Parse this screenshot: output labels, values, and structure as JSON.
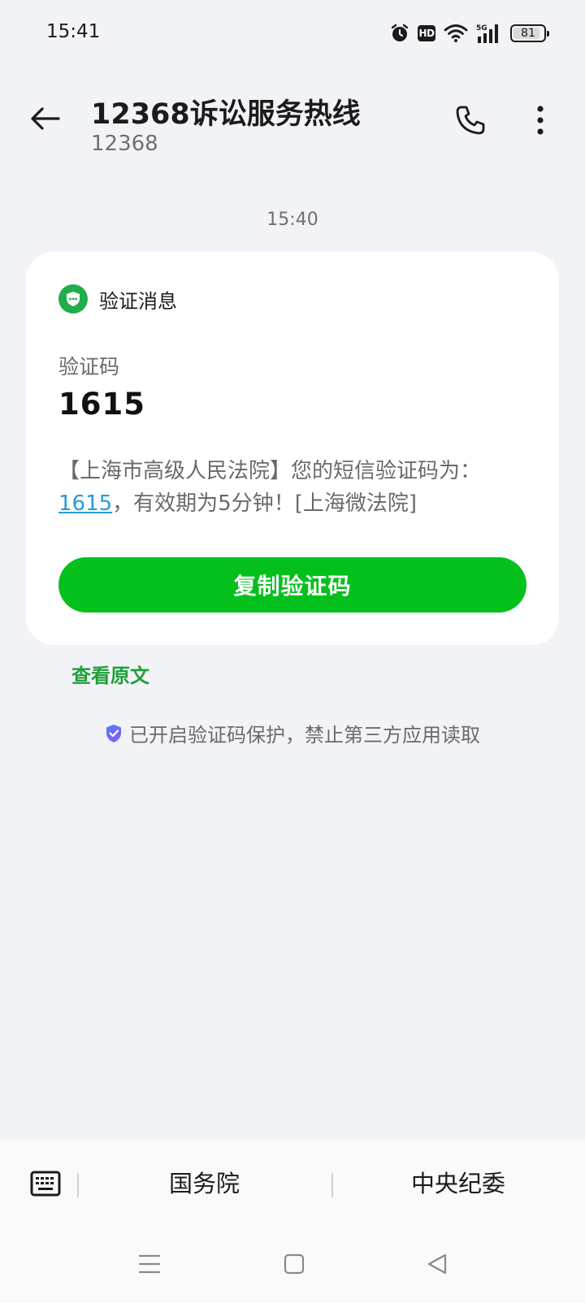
{
  "status_bar": {
    "time": "15:41",
    "battery_level": "81",
    "icons": [
      "alarm-icon",
      "hd-icon",
      "wifi-icon",
      "5g-signal-icon",
      "battery-icon"
    ],
    "hd_label": "HD"
  },
  "header": {
    "title": "12368诉讼服务热线",
    "subtitle": "12368"
  },
  "conversation": {
    "timestamp": "15:40",
    "card": {
      "label": "验证消息",
      "code_label": "验证码",
      "code": "1615",
      "body_line1": "【上海市高级人民法院】您的短信验证码为：",
      "body_code": "1615",
      "body_line2_rest": "，有效期为5分钟！[上海微法院]",
      "copy_button": "复制验证码"
    },
    "view_original": "查看原文",
    "protection_notice": "已开启验证码保护，禁止第三方应用读取"
  },
  "bottom_bar": {
    "quick_items": [
      "国务院",
      "中央纪委"
    ]
  },
  "colors": {
    "accent_green": "#04c01d",
    "link_blue": "#2a9ad8",
    "badge_green": "#1fae4b",
    "background": "#f2f3f6"
  }
}
